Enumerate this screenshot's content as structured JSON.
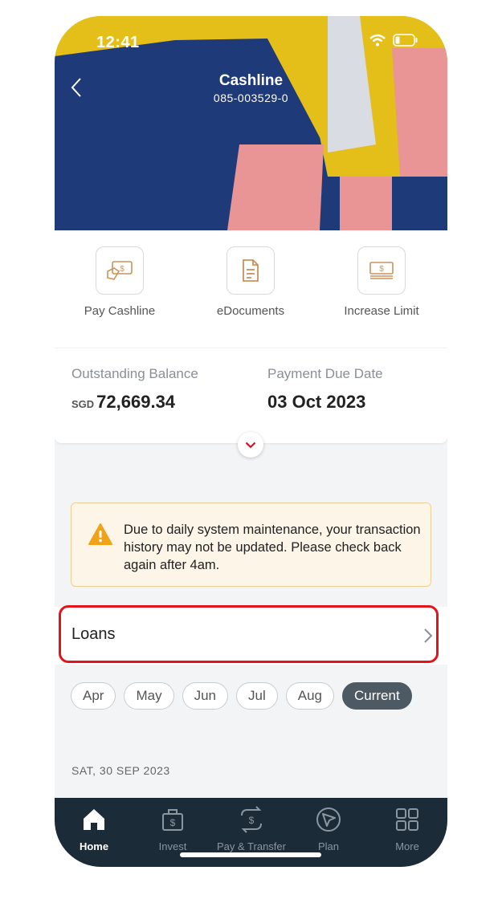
{
  "status": {
    "time": "12:41"
  },
  "header": {
    "title": "Cashline",
    "account_number": "085-003529-0"
  },
  "actions": [
    {
      "label": "Pay Cashline",
      "icon": "cash-icon"
    },
    {
      "label": "eDocuments",
      "icon": "document-icon"
    },
    {
      "label": "Increase Limit",
      "icon": "banknote-icon"
    }
  ],
  "balance": {
    "outstanding_label": "Outstanding Balance",
    "currency": "SGD",
    "outstanding_value": "72,669.34",
    "due_label": "Payment Due Date",
    "due_value": "03 Oct 2023"
  },
  "notice": {
    "text": "Due to daily system maintenance, your transaction history may not be updated. Please check back again after 4am."
  },
  "loans": {
    "label": "Loans"
  },
  "months": [
    "Apr",
    "May",
    "Jun",
    "Jul",
    "Aug",
    "Current"
  ],
  "transactions": {
    "date_header": "SAT, 30 SEP 2023"
  },
  "tabs": [
    {
      "label": "Home",
      "icon": "home-icon"
    },
    {
      "label": "Invest",
      "icon": "moneybag-icon"
    },
    {
      "label": "Pay & Transfer",
      "icon": "transfer-icon"
    },
    {
      "label": "Plan",
      "icon": "compass-icon"
    },
    {
      "label": "More",
      "icon": "grid-icon"
    }
  ],
  "colors": {
    "highlight": "#e4121b",
    "tabbar": "#1b2b37",
    "accent": "#c0392b"
  }
}
